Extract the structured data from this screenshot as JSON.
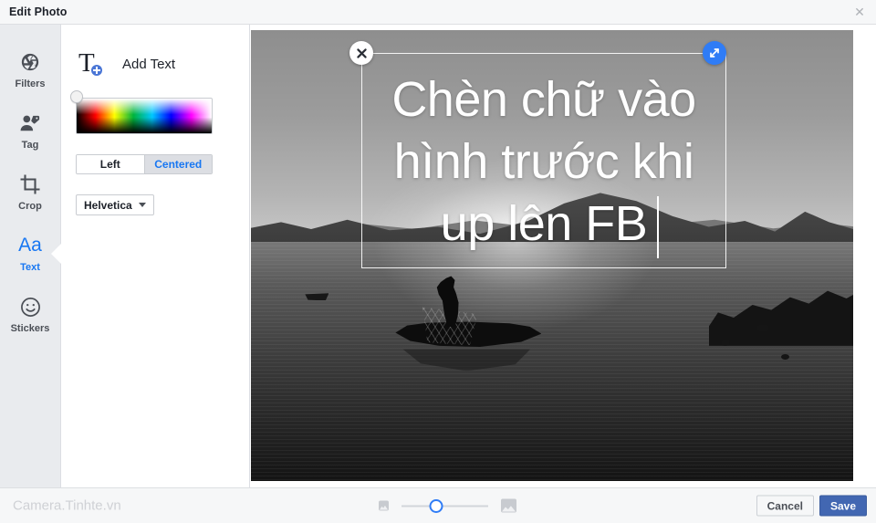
{
  "window": {
    "title": "Edit Photo",
    "close_icon": "close-icon"
  },
  "sidebar": {
    "items": [
      {
        "label": "Filters",
        "icon": "aperture-icon",
        "active": false
      },
      {
        "label": "Tag",
        "icon": "person-tag-icon",
        "active": false
      },
      {
        "label": "Crop",
        "icon": "crop-icon",
        "active": false
      },
      {
        "label": "Text",
        "icon": "aa-text-icon",
        "active": true
      },
      {
        "label": "Stickers",
        "icon": "smiley-icon",
        "active": false
      }
    ]
  },
  "options_panel": {
    "add_text_label": "Add Text",
    "add_text_icon": "text-plus-icon",
    "color_picker": {
      "name": "color-gradient-picker",
      "knob_position": "top-left",
      "selected_color": "#ffffff"
    },
    "alignment": {
      "options": [
        "Left",
        "Centered"
      ],
      "selected": "Centered"
    },
    "font": {
      "selected": "Helvetica",
      "caret_icon": "chevron-down-icon"
    }
  },
  "canvas": {
    "photo_description": "Black and white photo of a fisherman casting a net from a boat on a lake at sunset with mountains",
    "text_overlay": {
      "content": "Chèn chữ vào hình trước khi up lên FB",
      "lines": [
        "Chèn chữ vào",
        "hình trước khi",
        "up lên FB"
      ],
      "color": "#ffffff",
      "font": "Helvetica",
      "alignment": "Centered"
    },
    "close_button_icon": "close-x-icon",
    "resize_handle_icon": "resize-diagonal-icon",
    "accent_color": "#2f7cf6"
  },
  "footer": {
    "watermark": "Camera.Tinhte.vn",
    "size_slider": {
      "name": "text-size-slider",
      "min_icon": "image-small-icon",
      "max_icon": "image-large-icon",
      "value_percent": 40
    },
    "cancel_label": "Cancel",
    "save_label": "Save",
    "save_color": "#4267b2"
  }
}
